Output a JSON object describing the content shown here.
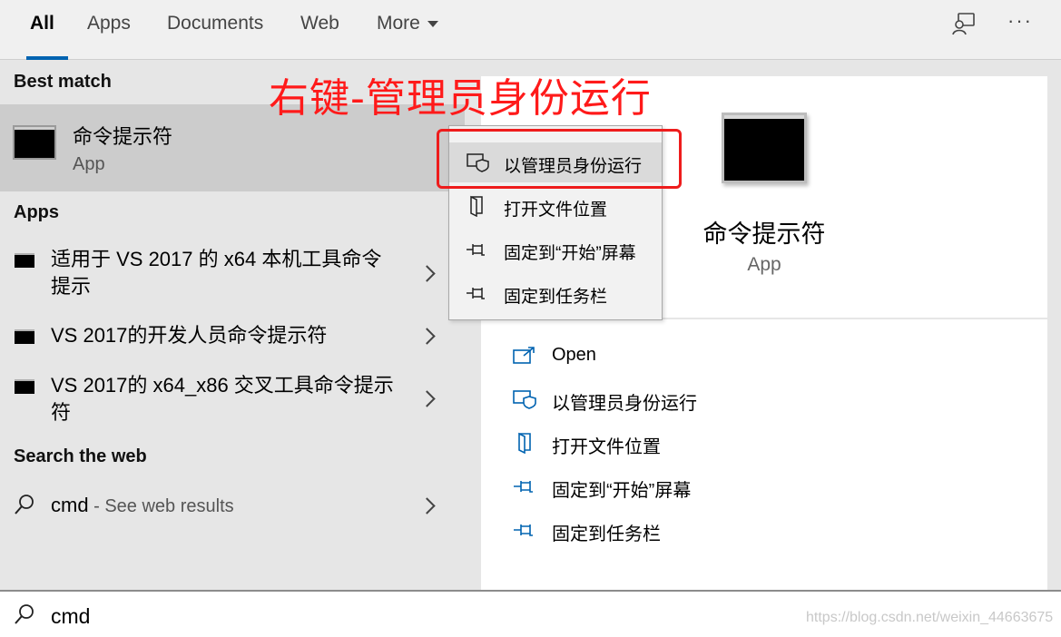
{
  "tabs": [
    {
      "label": "All",
      "active": true
    },
    {
      "label": "Apps"
    },
    {
      "label": "Documents"
    },
    {
      "label": "Web"
    },
    {
      "label": "More"
    }
  ],
  "header_icons": [
    "feedback-icon",
    "more-options-icon"
  ],
  "left": {
    "best_match_title": "Best match",
    "best_match": {
      "name": "命令提示符",
      "type": "App"
    },
    "apps_title": "Apps",
    "apps": [
      {
        "label": "适用于 VS 2017 的 x64 本机工具命令提示"
      },
      {
        "label": "VS 2017的开发人员命令提示符"
      },
      {
        "label": "VS 2017的 x64_x86 交叉工具命令提示符"
      }
    ],
    "web_title": "Search the web",
    "web": {
      "query": "cmd",
      "suffix": " - See web results"
    }
  },
  "context_menu": [
    {
      "label": "以管理员身份运行",
      "icon": "shield-icon",
      "highlighted": true
    },
    {
      "label": "打开文件位置",
      "icon": "folder-open-icon"
    },
    {
      "label": "固定到“开始”屏幕",
      "icon": "pin-icon"
    },
    {
      "label": "固定到任务栏",
      "icon": "pin-icon"
    }
  ],
  "preview": {
    "name": "命令提示符",
    "type": "App",
    "actions": [
      {
        "label": "Open",
        "icon": "open-icon"
      },
      {
        "label": "以管理员身份运行",
        "icon": "shield-icon"
      },
      {
        "label": "打开文件位置",
        "icon": "folder-open-icon"
      },
      {
        "label": "固定到“开始”屏幕",
        "icon": "pin-icon"
      },
      {
        "label": "固定到任务栏",
        "icon": "pin-icon"
      }
    ]
  },
  "annotation": {
    "text": "右键-管理员身份运行",
    "color": "#ff1a1a"
  },
  "search": {
    "value": "cmd"
  },
  "watermark": "https://blog.csdn.net/weixin_44663675",
  "colors": {
    "accent": "#0063b1",
    "highlight": "#cccccc"
  }
}
